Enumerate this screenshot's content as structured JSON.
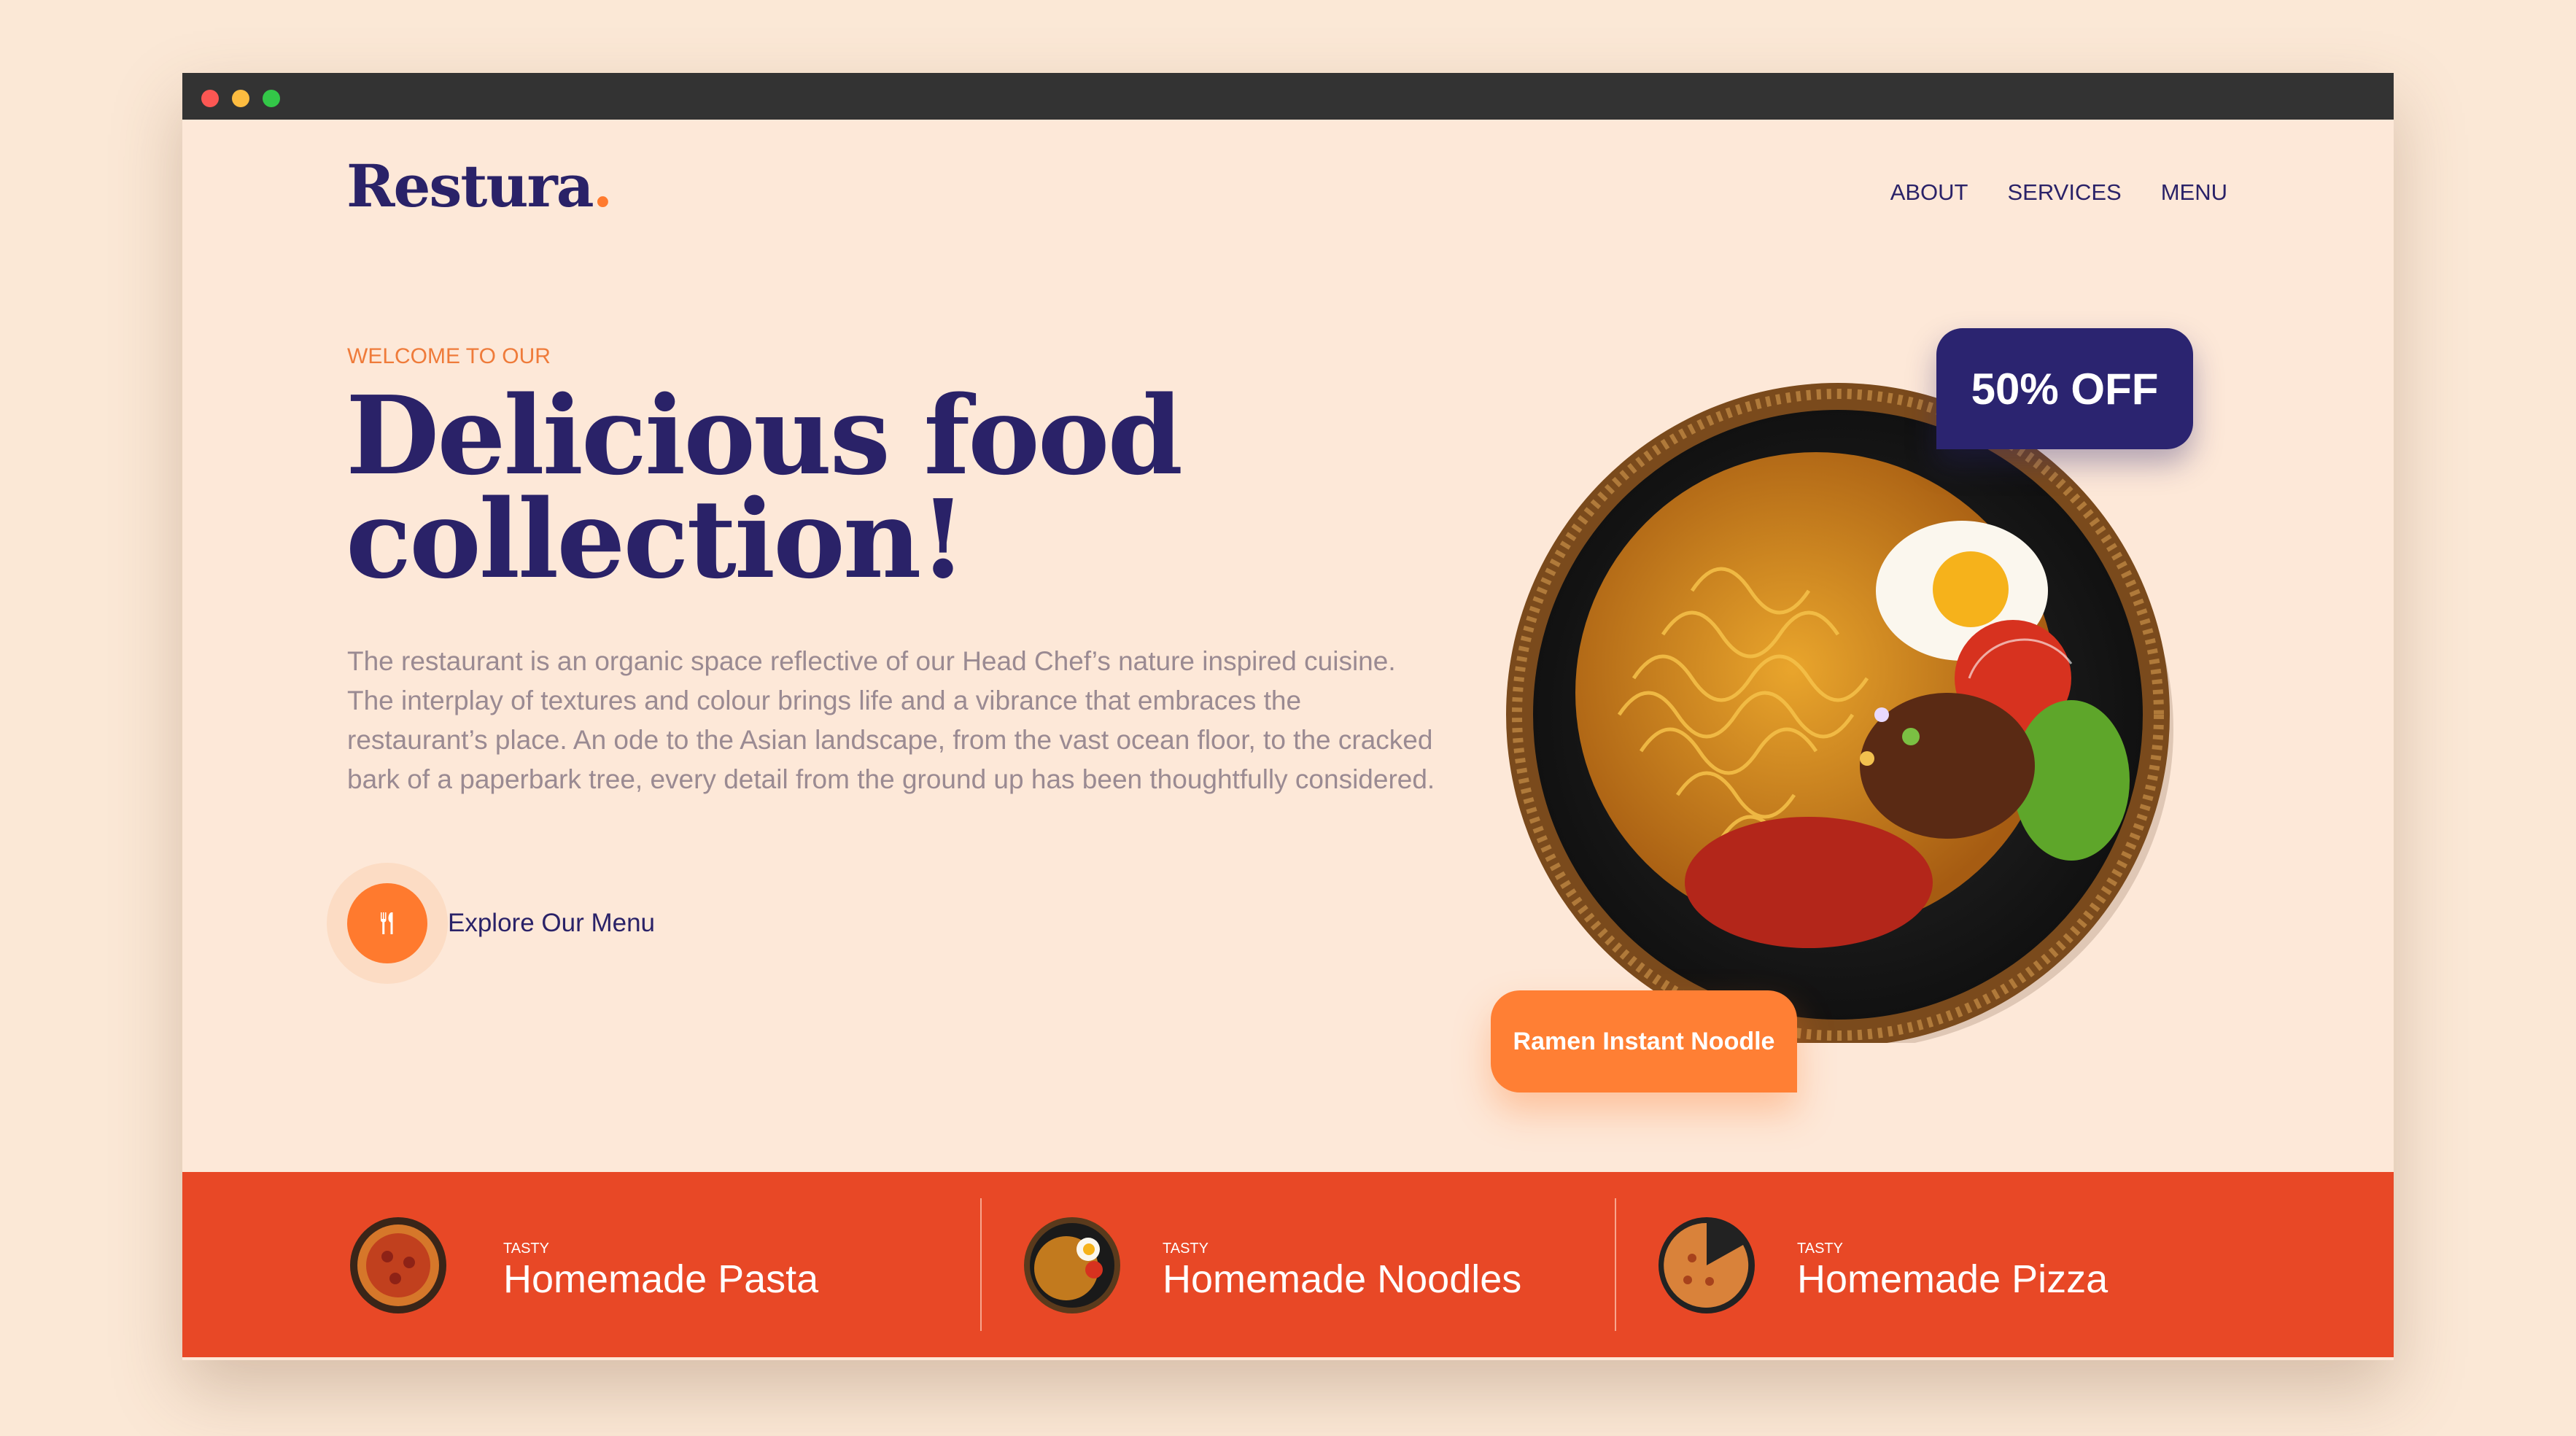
{
  "brand": {
    "name": "Restura",
    "dot": "."
  },
  "nav": {
    "items": [
      "ABOUT",
      "SERVICES",
      "MENU"
    ]
  },
  "hero": {
    "eyebrow": "WELCOME TO OUR",
    "title_line1": "Delicious food",
    "title_line2": "collection!",
    "description": "The restaurant is an organic space reflective of our Head Chef’s nature inspired cuisine. The interplay of textures and colour brings life and a vibrance that embraces the restaurant’s place. An ode to the Asian landscape, from the vast ocean floor, to the cracked bark of a paperbark tree, every detail from the ground up has been thoughtfully considered.",
    "cta_label": "Explore Our Menu"
  },
  "feature": {
    "badge": "50% OFF",
    "dish_name": "Ramen Instant Noodle"
  },
  "categories": [
    {
      "small": "TASTY",
      "title": "Homemade Pasta",
      "icon": "pasta-plate"
    },
    {
      "small": "TASTY",
      "title": "Homemade Noodles",
      "icon": "noodle-plate"
    },
    {
      "small": "TASTY",
      "title": "Homemade Pizza",
      "icon": "pizza"
    }
  ],
  "colors": {
    "page_bg": "#fbe8d6",
    "primary": "#2a2268",
    "accent": "#ff7a2e",
    "bar": "#e84826"
  }
}
